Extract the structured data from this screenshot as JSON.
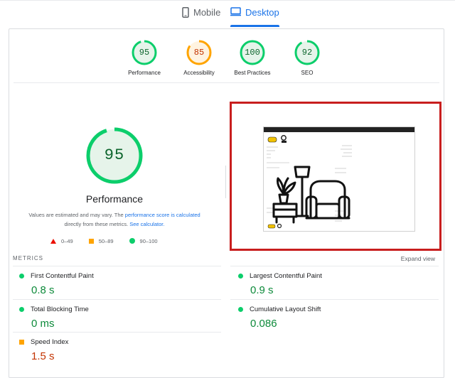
{
  "tabs": [
    {
      "label": "Mobile",
      "icon": "mobile-phone-icon",
      "active": false
    },
    {
      "label": "Desktop",
      "icon": "desktop-monitor-icon",
      "active": true
    }
  ],
  "gauges": [
    {
      "score": "95",
      "label": "Performance",
      "color": "#0cce6b",
      "text_color": "#0d652d",
      "fill": "#e6f4ea",
      "fraction": 0.95
    },
    {
      "score": "85",
      "label": "Accessibility",
      "color": "#ffa400",
      "text_color": "#c33300",
      "fill": "#fff3e0",
      "fraction": 0.85
    },
    {
      "score": "100",
      "label": "Best Practices",
      "color": "#0cce6b",
      "text_color": "#0d652d",
      "fill": "#e6f4ea",
      "fraction": 1.0
    },
    {
      "score": "92",
      "label": "SEO",
      "color": "#0cce6b",
      "text_color": "#0d652d",
      "fill": "#e6f4ea",
      "fraction": 0.92
    }
  ],
  "performance": {
    "score": "95",
    "fraction": 0.95,
    "title": "Performance",
    "note_prefix": "Values are estimated and may vary. The ",
    "note_link1": "performance score is calculated",
    "note_middle": " directly from these metrics. ",
    "note_link2": "See calculator."
  },
  "legend": [
    {
      "range": "0–49",
      "shape": "triangle",
      "color": "#eb0f00"
    },
    {
      "range": "50–89",
      "shape": "square",
      "color": "#ffa400"
    },
    {
      "range": "90–100",
      "shape": "circle",
      "color": "#0cce6b"
    }
  ],
  "metrics_header": {
    "label": "METRICS",
    "expand": "Expand view"
  },
  "metrics": [
    {
      "name": "First Contentful Paint",
      "value": "0.8 s",
      "status": "good"
    },
    {
      "name": "Largest Contentful Paint",
      "value": "0.9 s",
      "status": "good"
    },
    {
      "name": "Total Blocking Time",
      "value": "0 ms",
      "status": "good"
    },
    {
      "name": "Cumulative Layout Shift",
      "value": "0.086",
      "status": "good"
    },
    {
      "name": "Speed Index",
      "value": "1.5 s",
      "status": "average"
    }
  ],
  "screenshot": {
    "icon": "furniture-armchair-lamp-icon",
    "highlight_color": "#c81e1e"
  }
}
